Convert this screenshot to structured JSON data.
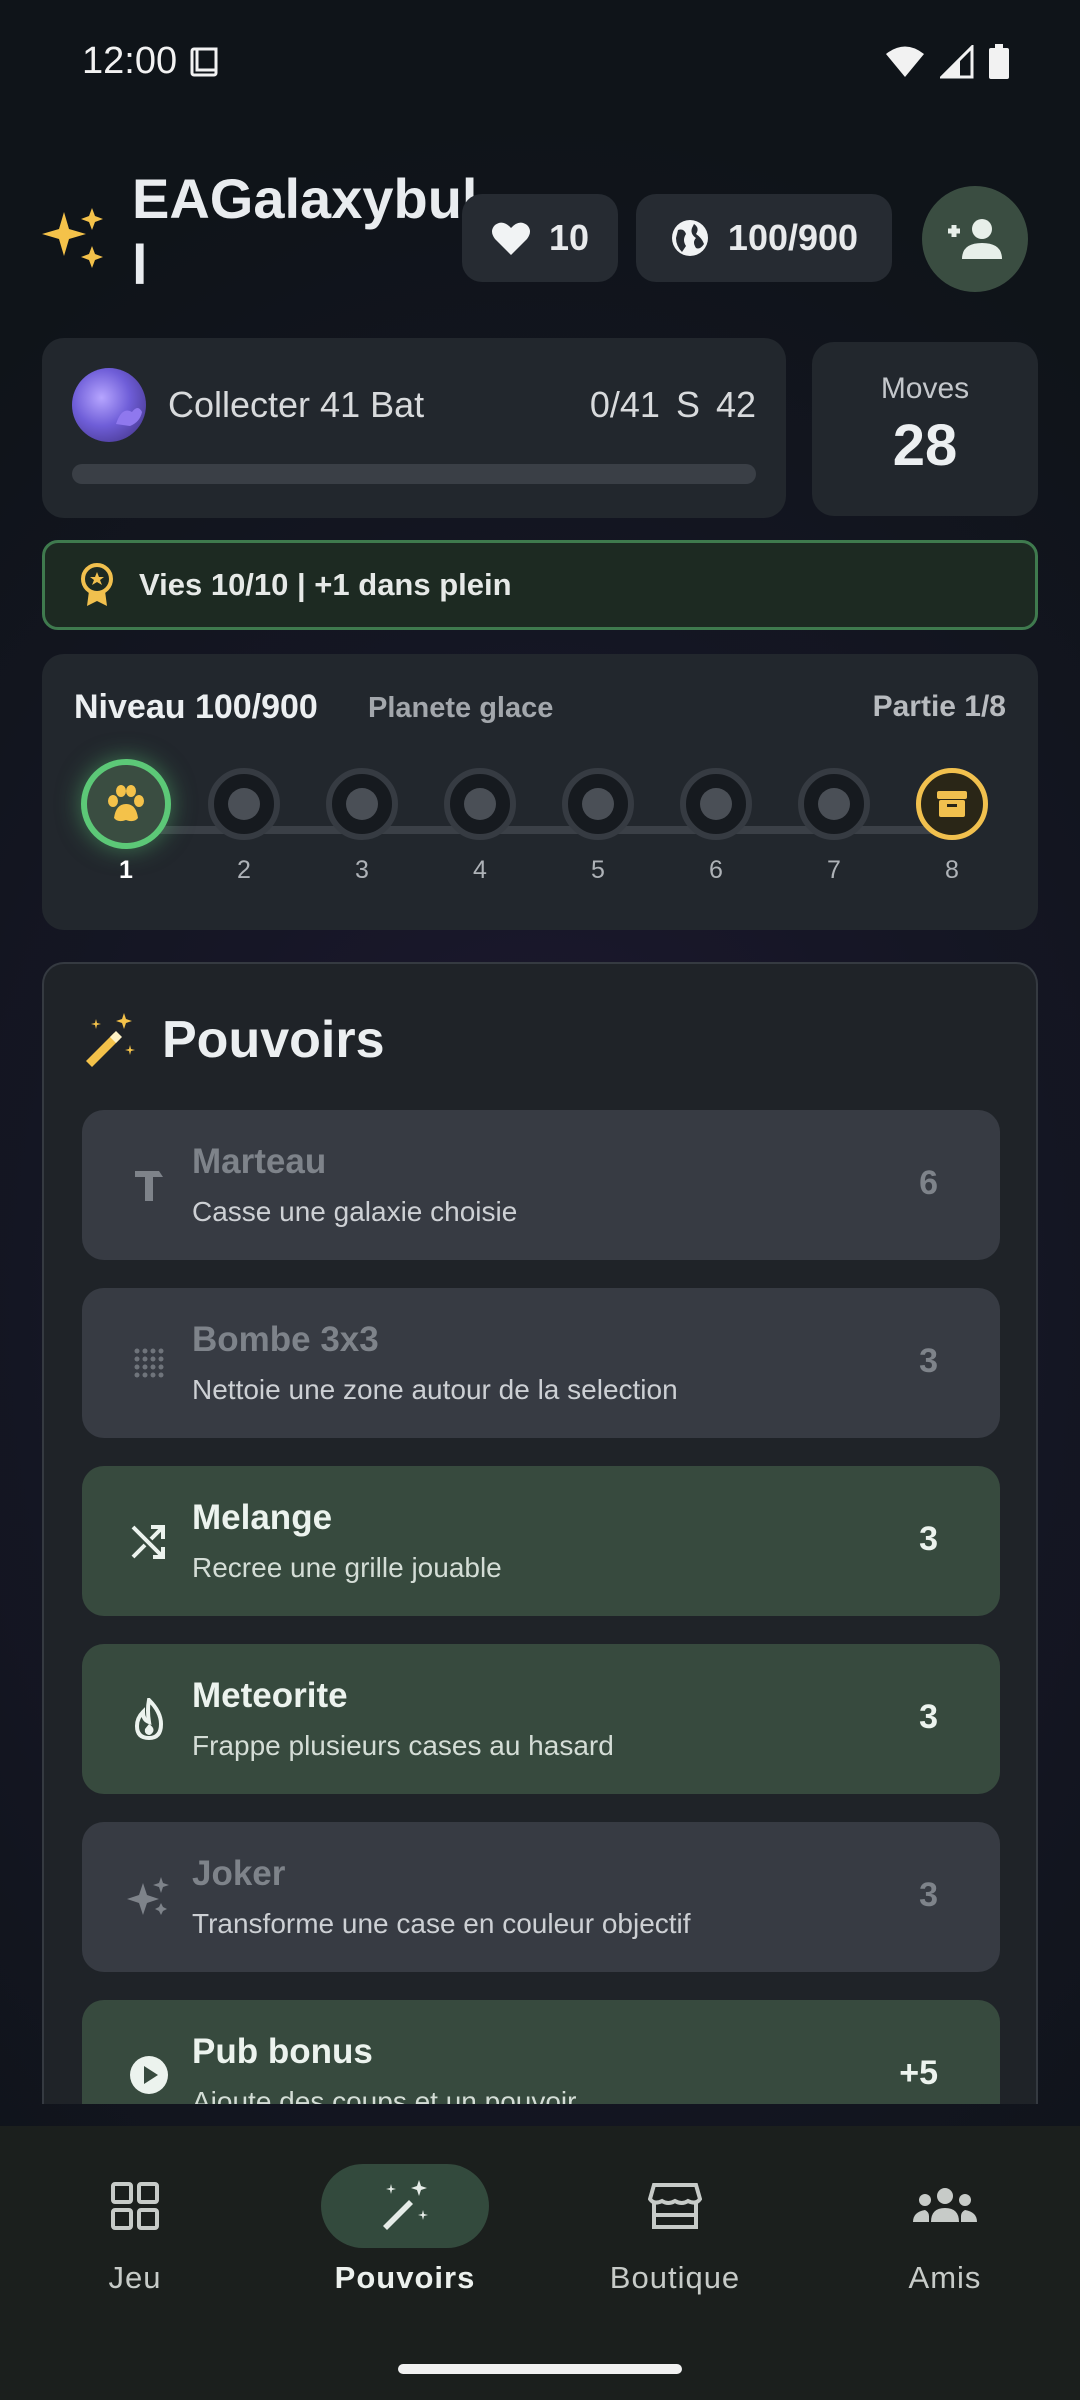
{
  "status_bar": {
    "time": "12:00"
  },
  "header": {
    "username": "EAGalaxybull",
    "lives": "10",
    "world_progress": "100/900"
  },
  "mission": {
    "label": "Collecter 41 Bat",
    "progress": "0/41",
    "score": "S 42",
    "progress_fraction": 0.0
  },
  "moves": {
    "label": "Moves",
    "value": "28"
  },
  "lives_banner": {
    "text": "Vies 10/10 | +1 dans plein"
  },
  "level": {
    "title": "Niveau 100/900",
    "planet": "Planete glace",
    "part": "Partie 1/8",
    "nodes": [
      "1",
      "2",
      "3",
      "4",
      "5",
      "6",
      "7",
      "8"
    ]
  },
  "powers": {
    "title": "Pouvoirs",
    "items": [
      {
        "name": "Marteau",
        "desc": "Casse une galaxie choisie",
        "count": "6",
        "icon": "hammer-icon",
        "enabled": false
      },
      {
        "name": "Bombe 3x3",
        "desc": "Nettoie une zone autour de la selection",
        "count": "3",
        "icon": "grid-dots-icon",
        "enabled": false
      },
      {
        "name": "Melange",
        "desc": "Recree une grille jouable",
        "count": "3",
        "icon": "shuffle-icon",
        "enabled": true
      },
      {
        "name": "Meteorite",
        "desc": "Frappe plusieurs cases au hasard",
        "count": "3",
        "icon": "flame-icon",
        "enabled": true
      },
      {
        "name": "Joker",
        "desc": "Transforme une case en couleur objectif",
        "count": "3",
        "icon": "sparkle-icon",
        "enabled": false
      },
      {
        "name": "Pub bonus",
        "desc": "Ajoute des coups et un pouvoir",
        "count": "+5",
        "icon": "play-circle-icon",
        "enabled": true
      }
    ]
  },
  "nav": {
    "items": [
      {
        "label": "Jeu",
        "icon": "grid-icon"
      },
      {
        "label": "Pouvoirs",
        "icon": "magic-wand-icon",
        "active": true
      },
      {
        "label": "Boutique",
        "icon": "store-icon"
      },
      {
        "label": "Amis",
        "icon": "group-icon"
      }
    ]
  }
}
